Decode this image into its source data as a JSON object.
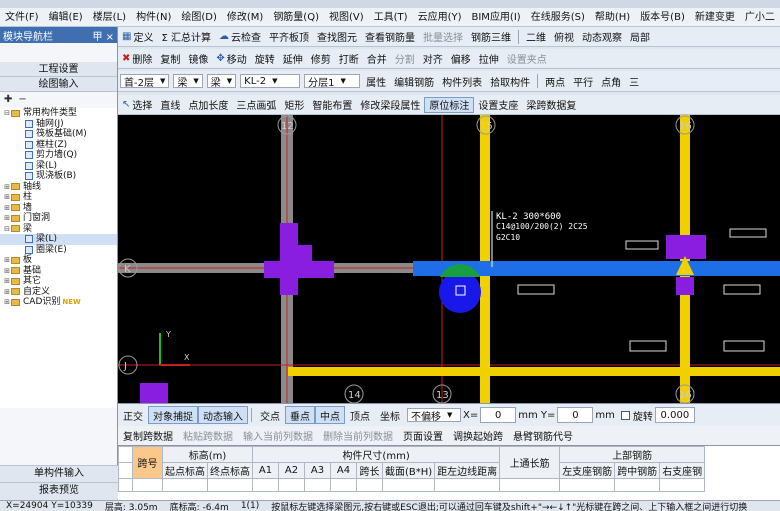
{
  "menu": [
    "文件(F)",
    "编辑(E)",
    "楼层(L)",
    "构件(N)",
    "绘图(D)",
    "修改(M)",
    "钢筋量(Q)",
    "视图(V)",
    "工具(T)",
    "云应用(Y)",
    "BIM应用(I)",
    "在线服务(S)",
    "帮助(H)",
    "版本号(B)",
    "新建变更",
    "广小二"
  ],
  "toolbar1": [
    "定义",
    "Σ 汇总计算",
    "云检查",
    "平齐板顶",
    "查找图元",
    "查看钢筋量",
    "批量选择",
    "钢筋三维",
    "二维",
    "俯视",
    "动态观察",
    "局部"
  ],
  "toolbar2": {
    "floor": "首-2层",
    "type1": "梁",
    "type2": "梁",
    "member": "KL-2",
    "layer": "分层1",
    "buttons": [
      "属性",
      "编辑钢筋",
      "构件列表",
      "拾取构件",
      "两点",
      "平行",
      "点角",
      "三"
    ]
  },
  "edit_toolbar": [
    "删除",
    "复制",
    "镜像",
    "移动",
    "旋转",
    "延伸",
    "修剪",
    "打断",
    "合并",
    "分割",
    "对齐",
    "偏移",
    "拉伸",
    "设置夹点"
  ],
  "toolbar3": [
    "选择",
    "直线",
    "点加长度",
    "三点画弧",
    "矩形",
    "智能布置",
    "修改梁段属性",
    "原位标注",
    "设置支座",
    "梁跨数据复"
  ],
  "left_panel": {
    "title": "模块导航栏",
    "pin": "甲 ×",
    "buttons": [
      "工程设置",
      "绘图输入"
    ],
    "tree": [
      {
        "label": "常用构件类型",
        "level": 0,
        "kind": "folder",
        "open": true
      },
      {
        "label": "轴网(J)",
        "level": 1,
        "kind": "leaf"
      },
      {
        "label": "筏板基础(M)",
        "level": 1,
        "kind": "leaf"
      },
      {
        "label": "框柱(Z)",
        "level": 1,
        "kind": "leaf"
      },
      {
        "label": "剪力墙(Q)",
        "level": 1,
        "kind": "leaf"
      },
      {
        "label": "梁(L)",
        "level": 1,
        "kind": "leaf"
      },
      {
        "label": "现浇板(B)",
        "level": 1,
        "kind": "leaf"
      },
      {
        "label": "轴线",
        "level": 0,
        "kind": "folder",
        "open": false
      },
      {
        "label": "柱",
        "level": 0,
        "kind": "folder",
        "open": false
      },
      {
        "label": "墙",
        "level": 0,
        "kind": "folder",
        "open": false
      },
      {
        "label": "门窗洞",
        "level": 0,
        "kind": "folder",
        "open": false
      },
      {
        "label": "梁",
        "level": 0,
        "kind": "folder",
        "open": true
      },
      {
        "label": "梁(L)",
        "level": 1,
        "kind": "leaf",
        "selected": true
      },
      {
        "label": "圈梁(E)",
        "level": 1,
        "kind": "leaf"
      },
      {
        "label": "板",
        "level": 0,
        "kind": "folder",
        "open": false
      },
      {
        "label": "基础",
        "level": 0,
        "kind": "folder",
        "open": false
      },
      {
        "label": "其它",
        "level": 0,
        "kind": "folder",
        "open": false
      },
      {
        "label": "自定义",
        "level": 0,
        "kind": "folder",
        "open": false
      },
      {
        "label": "CAD识别",
        "level": 0,
        "kind": "folder",
        "open": false,
        "badge": "NEW"
      }
    ],
    "bottom": [
      "单构件输入",
      "报表预览"
    ]
  },
  "canvas": {
    "axis_labels_top": [
      "12",
      "15",
      "16"
    ],
    "axis_labels_bottom": [
      "14",
      "13",
      "16"
    ],
    "axis_labels_left": [
      "K",
      "J"
    ],
    "annotation": [
      "KL-2 300*600",
      "C14@100/200(2) 2C25",
      "G2C10"
    ]
  },
  "snapbar": {
    "items": [
      "正交",
      "对象捕捉",
      "动态输入",
      "交点",
      "垂点",
      "中点",
      "顶点",
      "坐标"
    ],
    "mode": "不偏移",
    "x_label": "X=",
    "x_value": "0",
    "y_label": "mm Y=",
    "y_value": "0",
    "unit": "mm",
    "rotate_label": "旋转",
    "rotate_value": "0.000"
  },
  "grid_toolbar": [
    "复制跨数据",
    "粘贴跨数据",
    "输入当前列数据",
    "删除当前列数据",
    "页面设置",
    "调换起始跨",
    "悬臂钢筋代号"
  ],
  "grid": {
    "span_col": "跨号",
    "group_elev": "标高(m)",
    "group_size": "构件尺寸(mm)",
    "top_through": "上通长筋",
    "group_top": "上部钢筋",
    "cols": [
      "起点标高",
      "终点标高",
      "A1",
      "A2",
      "A3",
      "A4",
      "跨长",
      "截面(B*H)",
      "距左边线距离",
      "左支座钢筋",
      "跨中钢筋",
      "右支座钢"
    ]
  },
  "status": {
    "coords": "X=24904 Y=10339",
    "floor_height": "层高: 3.05m",
    "bottom_elev": "底标高: -6.4m",
    "count": "1(1)",
    "hint": "按鼠标左键选择梁图元,按右键或ESC退出;可以通过回车键及shift+\"→←↓↑\"光标键在跨之间、上下输入框之间进行切换"
  },
  "colors": {
    "beam_yellow": "#f0d000",
    "beam_blue": "#1e6ee8",
    "column_purple": "#8a1ee0",
    "axis_red": "#c82020",
    "grid_gray": "#8a8a8a"
  }
}
